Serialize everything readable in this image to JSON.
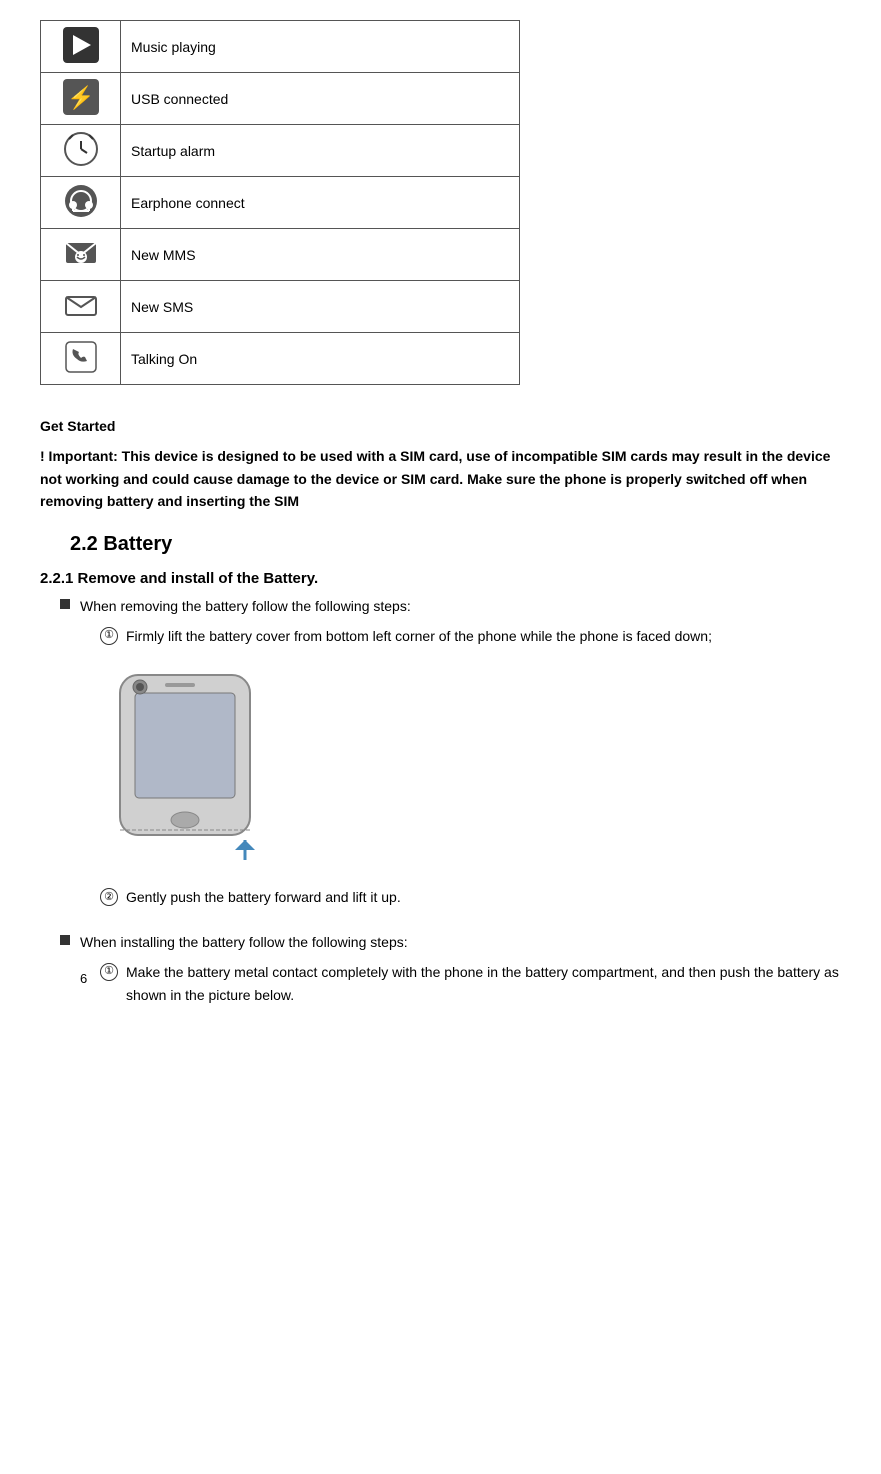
{
  "table": {
    "rows": [
      {
        "icon": "▶",
        "icon_style": "dark",
        "desc": "Music playing"
      },
      {
        "icon": "⚡",
        "icon_style": "usb",
        "desc": "USB connected"
      },
      {
        "icon": "⏰",
        "icon_style": "alarm",
        "desc": "Startup alarm"
      },
      {
        "icon": "🎧",
        "icon_style": "earphone",
        "desc": "Earphone connect"
      },
      {
        "icon": "✉",
        "icon_style": "mms",
        "desc": "New MMS"
      },
      {
        "icon": "✉",
        "icon_style": "sms",
        "desc": "New SMS"
      },
      {
        "icon": "📞",
        "icon_style": "talk",
        "desc": "Talking On"
      }
    ]
  },
  "get_started": {
    "title": "Get Started",
    "warning": "! Important: This device is designed to be used with a SIM card, use of incompatible SIM cards may result in the device not working and could cause damage to the device or SIM card. Make sure the phone is properly switched off when removing battery and inserting the SIM"
  },
  "section_2_2": {
    "heading": "2.2   Battery",
    "sub_heading": "2.2.1   Remove and install of the Battery.",
    "remove_intro": "When removing the battery follow the following steps:",
    "remove_steps": [
      "Firmly lift the battery cover from bottom left corner of the phone while the phone is faced down;",
      "Gently push the battery forward and lift it up."
    ],
    "install_intro": "When installing the battery follow the following steps:",
    "install_steps": [
      "Make the battery metal contact completely with the phone in the battery compartment, and then push the battery as shown in the picture below."
    ]
  },
  "page_number": "6"
}
